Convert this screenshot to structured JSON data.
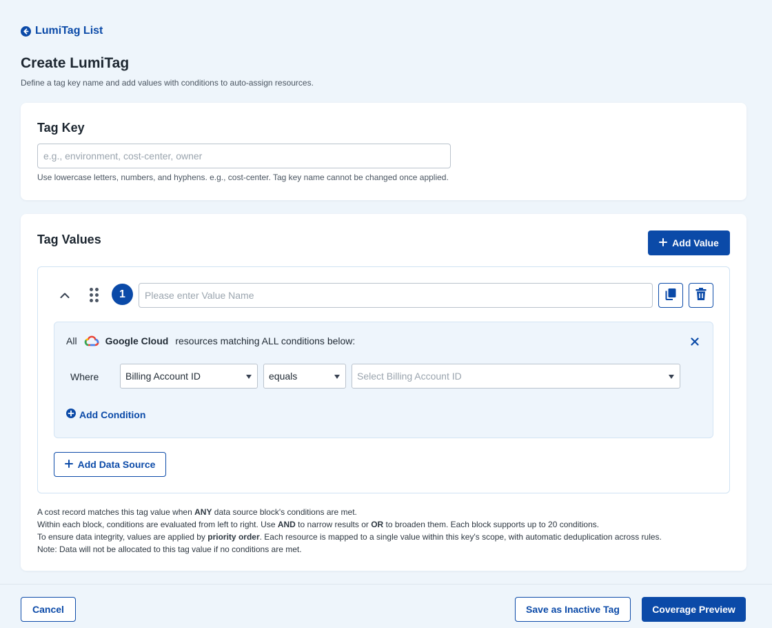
{
  "back_link": {
    "label": "LumiTag List"
  },
  "page": {
    "title": "Create LumiTag",
    "subtitle": "Define a tag key name and add values with conditions to auto-assign resources."
  },
  "tag_key": {
    "heading": "Tag Key",
    "value": "",
    "placeholder": "e.g., environment, cost-center, owner",
    "helper": "Use lowercase letters, numbers, and hyphens. e.g., cost-center. Tag key name cannot be changed once applied."
  },
  "tag_values": {
    "heading": "Tag Values",
    "add_value_label": "Add Value",
    "items": [
      {
        "index": "1",
        "name_value": "",
        "name_placeholder": "Please enter Value Name",
        "condition_block": {
          "prefix": "All",
          "provider": "Google Cloud",
          "suffix": "resources matching ALL conditions below:",
          "where_label": "Where",
          "field_select": "Billing Account ID",
          "operator_select": "equals",
          "value_placeholder": "Select Billing Account ID",
          "add_condition_label": "Add Condition"
        },
        "add_data_source_label": "Add Data Source"
      }
    ],
    "notes": {
      "line1_a": "A cost record matches this tag value when ",
      "line1_b": "ANY",
      "line1_c": " data source block's conditions are met.",
      "line2_a": "Within each block, conditions are evaluated from left to right. Use ",
      "line2_b": "AND",
      "line2_c": " to narrow results or ",
      "line2_d": "OR",
      "line2_e": " to broaden them. Each block supports up to 20 conditions.",
      "line3_a": "To ensure data integrity, values are applied by ",
      "line3_b": "priority order",
      "line3_c": ". Each resource is mapped to a single value within this key's scope, with automatic deduplication across rules.",
      "line4": "Note: Data will not be allocated to this tag value if no conditions are met."
    }
  },
  "footer": {
    "cancel_label": "Cancel",
    "save_inactive_label": "Save as Inactive Tag",
    "coverage_preview_label": "Coverage Preview"
  },
  "colors": {
    "primary": "#0b4aa8",
    "background": "#eef5fb",
    "condition_block_bg": "#eef5fc"
  },
  "icons": [
    "arrow-left-circle-icon",
    "plus-icon",
    "chevron-up-icon",
    "drag-handle-icon",
    "copy-icon",
    "trash-icon",
    "google-cloud-icon",
    "close-icon",
    "plus-circle-icon"
  ]
}
